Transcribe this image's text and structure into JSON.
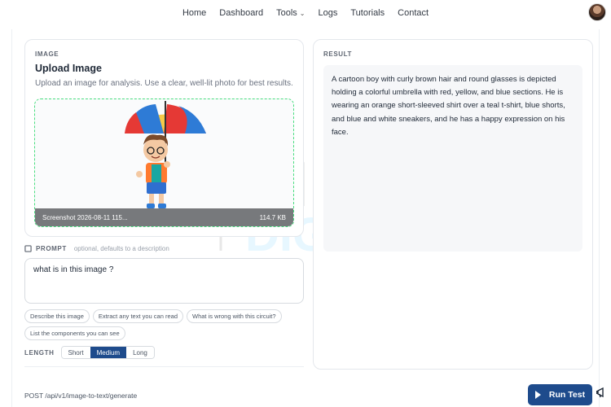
{
  "nav": {
    "items": [
      {
        "label": "Home"
      },
      {
        "label": "Dashboard"
      },
      {
        "label": "Tools"
      },
      {
        "label": "Logs"
      },
      {
        "label": "Tutorials"
      },
      {
        "label": "Contact"
      }
    ]
  },
  "image_card": {
    "section_label": "IMAGE",
    "title": "Upload Image",
    "subtitle": "Upload an image for analysis. Use a clear, well-lit photo for best results.",
    "file_name": "Screenshot 2026-08-11 115...",
    "file_size": "114.7 KB"
  },
  "watermark": {
    "line1": "CIRCUIT",
    "line2": "DIGEST"
  },
  "prompt": {
    "label": "PROMPT",
    "hint": "optional, defaults to a description",
    "value": "what is in this image ?"
  },
  "suggestions": [
    "Describe this image",
    "Extract any text you can read",
    "What is wrong with this circuit?",
    "List the components you can see"
  ],
  "length": {
    "label": "LENGTH",
    "options": [
      "Short",
      "Medium",
      "Long"
    ],
    "selected": "Medium"
  },
  "result": {
    "section_label": "RESULT",
    "text": "A cartoon boy with curly brown hair and round glasses is depicted holding a colorful umbrella with red, yellow, and blue sections. He is wearing an orange short-sleeved shirt over a teal t-shirt, blue shorts, and blue and white sneakers, and he has a happy expression on his face."
  },
  "footer": {
    "endpoint": "POST /api/v1/image-to-text/generate",
    "run_label": "Run Test"
  },
  "colors": {
    "accent": "#1e4b8c",
    "dropzone_border": "#4ade80"
  }
}
